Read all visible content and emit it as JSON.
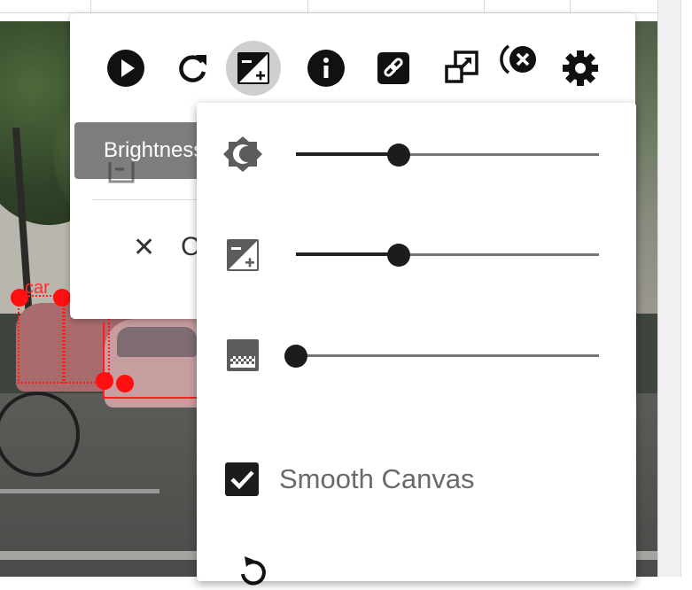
{
  "toolbar": {
    "buttons": [
      {
        "name": "play-button",
        "icon": "play-circle-icon",
        "active": false
      },
      {
        "name": "refresh-button",
        "icon": "refresh-icon",
        "active": false
      },
      {
        "name": "adjustments-button",
        "icon": "brightness-contrast-icon",
        "active": true
      },
      {
        "name": "info-button",
        "icon": "info-circle-icon",
        "active": false
      },
      {
        "name": "link-button",
        "icon": "link-icon",
        "active": false
      },
      {
        "name": "popout-button",
        "icon": "popout-icon",
        "active": false
      },
      {
        "name": "clear-button",
        "icon": "close-circle-icon",
        "active": false
      },
      {
        "name": "settings-button",
        "icon": "gear-icon",
        "active": false
      }
    ],
    "tooltip": "Brightness"
  },
  "menu": {
    "clear_label": "C"
  },
  "scene": {
    "label_tag": "car"
  },
  "adjustments": {
    "brightness": {
      "icon": "brightness-icon",
      "value": 0.34
    },
    "contrast": {
      "icon": "contrast-icon",
      "value": 0.34
    },
    "saturation": {
      "icon": "gradient-icon",
      "value": 0.0
    },
    "smooth_canvas": {
      "label": "Smooth Canvas",
      "checked": true
    },
    "reset": {
      "icon": "reset-icon"
    }
  },
  "colors": {
    "annotation": "#ff1d1d",
    "slider_thumb": "#1c1c1c",
    "tooltip_bg": "#7d7d7d",
    "active_button_bg": "#cfcfcf"
  }
}
